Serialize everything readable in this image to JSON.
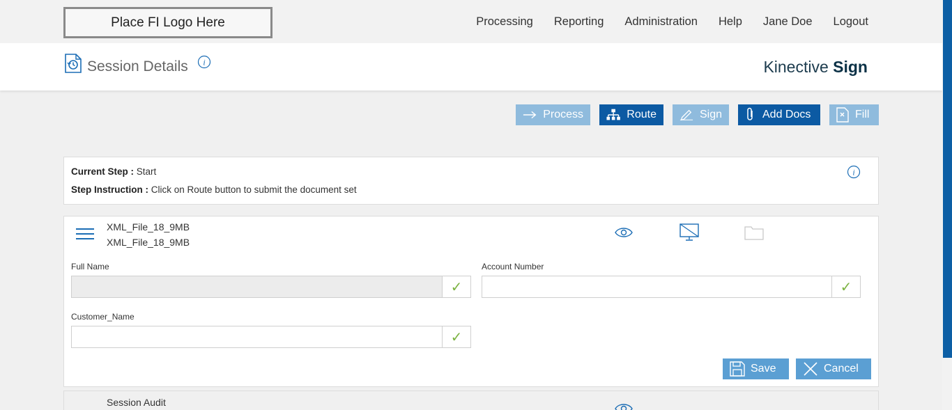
{
  "logo": {
    "text": "Place FI Logo Here"
  },
  "nav": {
    "items": [
      {
        "label": "Processing"
      },
      {
        "label": "Reporting"
      },
      {
        "label": "Administration"
      },
      {
        "label": "Help"
      },
      {
        "label": "Jane Doe"
      },
      {
        "label": "Logout"
      }
    ]
  },
  "header": {
    "title": "Session Details",
    "brand_light": "Kinective",
    "brand_bold": "Sign"
  },
  "toolbar": {
    "process": "Process",
    "route": "Route",
    "sign": "Sign",
    "add_docs": "Add Docs",
    "fill": "Fill"
  },
  "step": {
    "current_label": "Current Step :",
    "current_value": "Start",
    "instruction_label": "Step Instruction :",
    "instruction_value": "Click on Route button to submit the document set"
  },
  "document": {
    "name_1": "XML_File_18_9MB",
    "name_2": "XML_File_18_9MB",
    "fields": {
      "full_name": {
        "label": "Full Name",
        "value": ""
      },
      "account_number": {
        "label": "Account Number",
        "value": ""
      },
      "customer_name": {
        "label": "Customer_Name",
        "value": ""
      }
    },
    "check_mark": "✓",
    "save": "Save",
    "cancel": "Cancel"
  },
  "audit": {
    "title": "Session Audit"
  },
  "colors": {
    "accent": "#0c5aa3",
    "button_disabled": "#8fbbdd",
    "button_secondary": "#5b9fd3",
    "check": "#7cb342"
  }
}
